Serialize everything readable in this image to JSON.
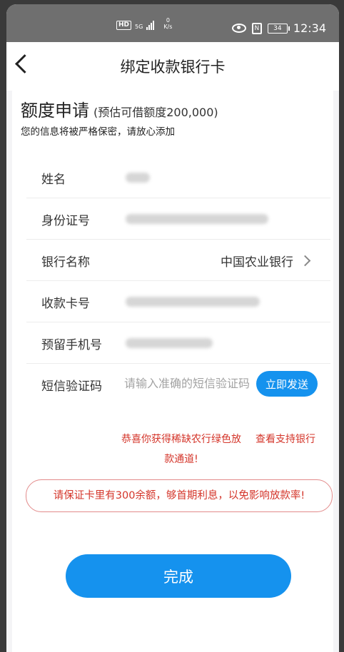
{
  "status_bar": {
    "hd": "HD",
    "network_type": "5G",
    "net_speed_value": "0",
    "net_speed_unit": "K/s",
    "battery": "34",
    "time": "12:34"
  },
  "header": {
    "title": "绑定收款银行卡"
  },
  "intro": {
    "heading": "额度申请",
    "subheading": "(预估可借额度200,000)",
    "note": "您的信息将被严格保密，请放心添加"
  },
  "form": {
    "name_label": "姓名",
    "id_label": "身份证号",
    "bank_label": "银行名称",
    "bank_value": "中国农业银行",
    "card_label": "收款卡号",
    "phone_label": "预留手机号",
    "sms_label": "短信验证码",
    "sms_placeholder": "请输入准确的短信验证码",
    "send_button": "立即发送",
    "promo_text": "恭喜你获得稀缺农行绿色放款通道!",
    "support_link": "查看支持银行"
  },
  "warning": "请保证卡里有300余额，够首期利息，以免影响放款率!",
  "done_button": "完成",
  "colors": {
    "accent": "#1592ee",
    "alert": "#d4352a"
  }
}
